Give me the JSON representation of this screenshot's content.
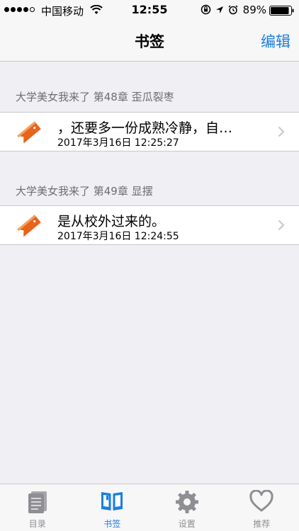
{
  "status_bar": {
    "carrier": "中国移动",
    "time": "12:55",
    "battery": "89%"
  },
  "nav": {
    "title": "书签",
    "edit_label": "编辑"
  },
  "sections": [
    {
      "header": "大学美女我来了 第48章 歪瓜裂枣",
      "entry": {
        "title": "，还要多一份成熟冷静，自…",
        "date": "2017年3月16日 12:25:27"
      }
    },
    {
      "header": "大学美女我来了 第49章 显摆",
      "entry": {
        "title": "是从校外过来的。",
        "date": "2017年3月16日 12:24:55"
      }
    }
  ],
  "tabs": [
    {
      "label": "目录",
      "icon": "book-list-icon",
      "active": false
    },
    {
      "label": "书签",
      "icon": "open-book-icon",
      "active": true
    },
    {
      "label": "设置",
      "icon": "gear-icon",
      "active": false
    },
    {
      "label": "推荐",
      "icon": "heart-icon",
      "active": false
    }
  ],
  "colors": {
    "accent": "#1a7ee3",
    "background": "#efeff4",
    "bookmark": "#e8631c"
  }
}
